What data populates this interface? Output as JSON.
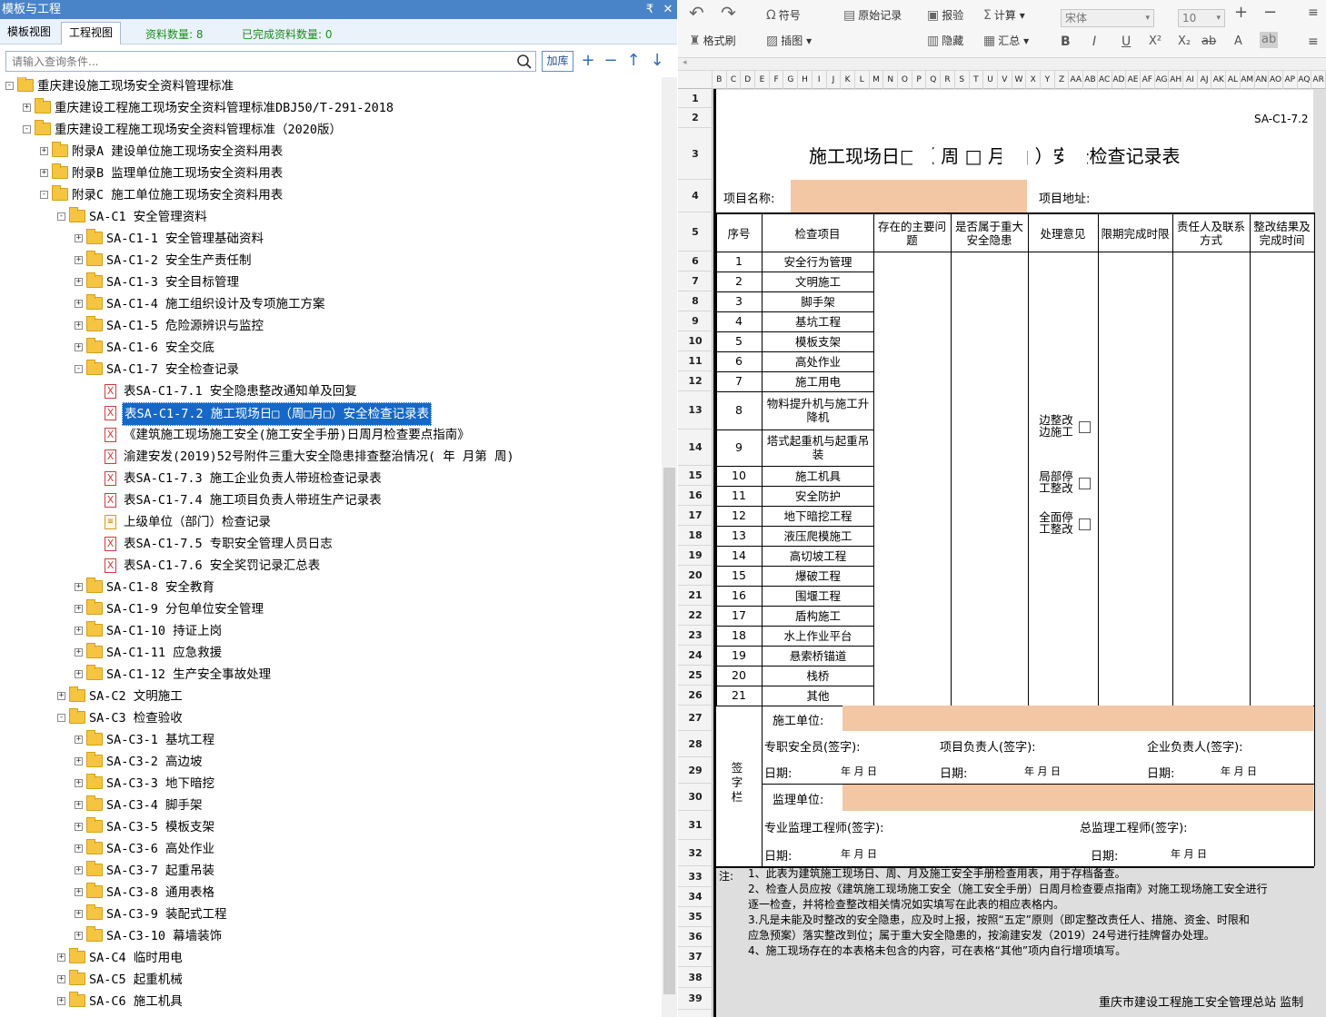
{
  "panel": {
    "title": "模板与工程",
    "pin_glyph": "₹",
    "close_glyph": "✕"
  },
  "tabs": [
    {
      "label": "模板视图"
    },
    {
      "label": "工程视图"
    }
  ],
  "counts": {
    "materials": "资料数量: 8",
    "completed": "已完成资料数量: 0"
  },
  "search": {
    "placeholder": "请输入查询条件...",
    "add_label": "加库"
  },
  "tree": [
    {
      "label": "重庆建设施工现场安全资料管理标准",
      "level": 0,
      "type": "folder",
      "exp": "-"
    },
    {
      "label": "重庆建设工程施工现场安全资料管理标准DBJ50/T-291-2018",
      "level": 1,
      "type": "folder",
      "exp": "+"
    },
    {
      "label": "重庆建设工程施工现场安全资料管理标准（2020版）",
      "level": 1,
      "type": "folder",
      "exp": "-"
    },
    {
      "label": "附录A 建设单位施工现场安全资料用表",
      "level": 2,
      "type": "folder",
      "exp": "+"
    },
    {
      "label": "附录B 监理单位施工现场安全资料用表",
      "level": 2,
      "type": "folder",
      "exp": "+"
    },
    {
      "label": "附录C 施工单位施工现场安全资料用表",
      "level": 2,
      "type": "folder",
      "exp": "-"
    },
    {
      "label": "SA-C1 安全管理资料",
      "level": 3,
      "type": "folder",
      "exp": "-"
    },
    {
      "label": "SA-C1-1 安全管理基础资料",
      "level": 4,
      "type": "folder",
      "exp": "+"
    },
    {
      "label": "SA-C1-2 安全生产责任制",
      "level": 4,
      "type": "folder",
      "exp": "+"
    },
    {
      "label": "SA-C1-3 安全目标管理",
      "level": 4,
      "type": "folder",
      "exp": "+"
    },
    {
      "label": "SA-C1-4 施工组织设计及专项施工方案",
      "level": 4,
      "type": "folder",
      "exp": "+"
    },
    {
      "label": "SA-C1-5 危险源辨识与监控",
      "level": 4,
      "type": "folder",
      "exp": "+"
    },
    {
      "label": "SA-C1-6 安全交底",
      "level": 4,
      "type": "folder",
      "exp": "+"
    },
    {
      "label": "SA-C1-7 安全检查记录",
      "level": 4,
      "type": "folder",
      "exp": "-"
    },
    {
      "label": "表SA-C1-7.1 安全隐患整改通知单及回复",
      "level": 5,
      "type": "xdoc"
    },
    {
      "label": "表SA-C1-7.2 施工现场日□（周□月□）安全检查记录表",
      "level": 5,
      "type": "xdoc",
      "selected": true
    },
    {
      "label": "《建筑施工现场施工安全(施工安全手册)日周月检查要点指南》",
      "level": 5,
      "type": "xdoc"
    },
    {
      "label": "渝建安发(2019)52号附件三重大安全隐患排查整治情况(   年   月第   周)",
      "level": 5,
      "type": "xdoc"
    },
    {
      "label": "表SA-C1-7.3 施工企业负责人带班检查记录表",
      "level": 5,
      "type": "xdoc"
    },
    {
      "label": "表SA-C1-7.4 施工项目负责人带班生产记录表",
      "level": 5,
      "type": "xdoc"
    },
    {
      "label": "上级单位（部门）检查记录",
      "level": 5,
      "type": "ndoc"
    },
    {
      "label": "表SA-C1-7.5 专职安全管理人员日志",
      "level": 5,
      "type": "xdoc"
    },
    {
      "label": "表SA-C1-7.6 安全奖罚记录汇总表",
      "level": 5,
      "type": "xdoc"
    },
    {
      "label": "SA-C1-8 安全教育",
      "level": 4,
      "type": "folder",
      "exp": "+"
    },
    {
      "label": "SA-C1-9 分包单位安全管理",
      "level": 4,
      "type": "folder",
      "exp": "+"
    },
    {
      "label": "SA-C1-10 持证上岗",
      "level": 4,
      "type": "folder",
      "exp": "+"
    },
    {
      "label": "SA-C1-11 应急救援",
      "level": 4,
      "type": "folder",
      "exp": "+"
    },
    {
      "label": "SA-C1-12 生产安全事故处理",
      "level": 4,
      "type": "folder",
      "exp": "+"
    },
    {
      "label": "SA-C2 文明施工",
      "level": 3,
      "type": "folder",
      "exp": "+"
    },
    {
      "label": "SA-C3 检查验收",
      "level": 3,
      "type": "folder",
      "exp": "-"
    },
    {
      "label": "SA-C3-1 基坑工程",
      "level": 4,
      "type": "folder",
      "exp": "+"
    },
    {
      "label": "SA-C3-2 高边坡",
      "level": 4,
      "type": "folder",
      "exp": "+"
    },
    {
      "label": "SA-C3-3 地下暗挖",
      "level": 4,
      "type": "folder",
      "exp": "+"
    },
    {
      "label": "SA-C3-4 脚手架",
      "level": 4,
      "type": "folder",
      "exp": "+"
    },
    {
      "label": "SA-C3-5 模板支架",
      "level": 4,
      "type": "folder",
      "exp": "+"
    },
    {
      "label": "SA-C3-6 高处作业",
      "level": 4,
      "type": "folder",
      "exp": "+"
    },
    {
      "label": "SA-C3-7 起重吊装",
      "level": 4,
      "type": "folder",
      "exp": "+"
    },
    {
      "label": "SA-C3-8 通用表格",
      "level": 4,
      "type": "folder",
      "exp": "+"
    },
    {
      "label": "SA-C3-9 装配式工程",
      "level": 4,
      "type": "folder",
      "exp": "+"
    },
    {
      "label": "SA-C3-10 幕墙装饰",
      "level": 4,
      "type": "folder",
      "exp": "+"
    },
    {
      "label": "SA-C4 临时用电",
      "level": 3,
      "type": "folder",
      "exp": "+"
    },
    {
      "label": "SA-C5 起重机械",
      "level": 3,
      "type": "folder",
      "exp": "+"
    },
    {
      "label": "SA-C6 施工机具",
      "level": 3,
      "type": "folder",
      "exp": "+"
    }
  ],
  "ribbon": {
    "undo_glyph": "↶",
    "redo_glyph": "↷",
    "symbol": "符号",
    "original": "原始记录",
    "acceptance": "报验",
    "calc": "计算",
    "format_painter": "格式刷",
    "insert_image": "插图",
    "hide": "隐藏",
    "summary": "汇总",
    "font": "宋体",
    "size": "10",
    "plus_glyph": "+",
    "minus_glyph": "−",
    "caret_glyph": "▾",
    "bold_glyph": "B",
    "italic_glyph": "I",
    "underline_glyph": "U",
    "sup_glyph": "X²",
    "sub_glyph": "X₂",
    "strike_glyph": "ab",
    "color_glyph": "A",
    "highlight_glyph": "ab"
  },
  "columns": [
    "B",
    "C",
    "D",
    "E",
    "F",
    "G",
    "H",
    "I",
    "J",
    "K",
    "L",
    "M",
    "N",
    "O",
    "P",
    "Q",
    "R",
    "S",
    "T",
    "U",
    "V",
    "W",
    "X",
    "Y",
    "Z",
    "AA",
    "AB",
    "AC",
    "AD",
    "AE",
    "AF",
    "AG",
    "AH",
    "AI",
    "AJ",
    "AK",
    "AL",
    "AM",
    "AN",
    "AO",
    "AP",
    "AQ",
    "AR"
  ],
  "rows": [
    "1",
    "2",
    "3",
    "4",
    "5",
    "6",
    "7",
    "8",
    "9",
    "10",
    "11",
    "12",
    "13",
    "14",
    "15",
    "16",
    "17",
    "18",
    "19",
    "20",
    "21",
    "22",
    "23",
    "24",
    "25",
    "26",
    "27",
    "28",
    "29",
    "30",
    "31",
    "32",
    "33",
    "34",
    "35",
    "36",
    "37",
    "38",
    "39"
  ],
  "form": {
    "code": "SA-C1-7.2",
    "title": "施工现场日□（ 周  □ 月  □ ）安全检查记录表",
    "project_name": "项目名称:",
    "project_address": "项目地址:",
    "headers": [
      "序号",
      "检查项目",
      "存在的主要问题",
      "是否属于重大安全隐患",
      "处理意见",
      "限期完成时限",
      "责任人及联系方式",
      "整改结果及完成时间"
    ],
    "items": [
      [
        "1",
        "安全行为管理"
      ],
      [
        "2",
        "文明施工"
      ],
      [
        "3",
        "脚手架"
      ],
      [
        "4",
        "基坑工程"
      ],
      [
        "5",
        "模板支架"
      ],
      [
        "6",
        "高处作业"
      ],
      [
        "7",
        "施工用电"
      ],
      [
        "8",
        "物料提升机与施工升降机"
      ],
      [
        "9",
        "塔式起重机与起重吊装"
      ],
      [
        "10",
        "施工机具"
      ],
      [
        "11",
        "安全防护"
      ],
      [
        "12",
        "地下暗挖工程"
      ],
      [
        "13",
        "液压爬模施工"
      ],
      [
        "14",
        "高切坡工程"
      ],
      [
        "15",
        "爆破工程"
      ],
      [
        "16",
        "围堰工程"
      ],
      [
        "17",
        "盾构施工"
      ],
      [
        "18",
        "水上作业平台"
      ],
      [
        "19",
        "悬索桥锚道"
      ],
      [
        "20",
        "栈桥"
      ],
      [
        "21",
        "其他"
      ]
    ],
    "opinions": [
      "边整改边施工",
      "局部停工整改",
      "全面停工整改"
    ],
    "sign_col": "签字栏",
    "construction_unit": "施工单位:",
    "safety_officer": "专职安全员(签字):",
    "project_leader": "项目负责人(签字):",
    "company_leader": "企业负责人(签字):",
    "date_label": "日期:",
    "date_value": "年   月   日",
    "supervision_unit": "监理单位:",
    "supervisor": "专业监理工程师(签字):",
    "chief_supervisor": "总监理工程师(签字):",
    "note_label": "注:",
    "notes": [
      "1、此表为建筑施工现场日、周、月及施工安全手册检查用表，用于存档备查。",
      "2、检查人员应按《建筑施工现场施工安全（施工安全手册）日周月检查要点指南》对施工现场施工安全进行",
      "逐一检查，并将检查整改相关情况如实填写在此表的相应表格内。",
      "3.凡是未能及时整改的安全隐患，应及时上报，按照“五定”原则（即定整改责任人、措施、资金、时限和",
      "应急预案）落实整改到位；属于重大安全隐患的，按渝建安发（2019）24号进行挂牌督办处理。",
      "4、施工现场存在的本表格未包含的内容，可在表格“其他”项内自行增项填写。"
    ],
    "footer": "重庆市建设工程施工安全管理总站   监制"
  },
  "colors": {
    "selection": "#1668c7",
    "peach": "#f3c7a3",
    "titlebar": "#4a84c8"
  }
}
